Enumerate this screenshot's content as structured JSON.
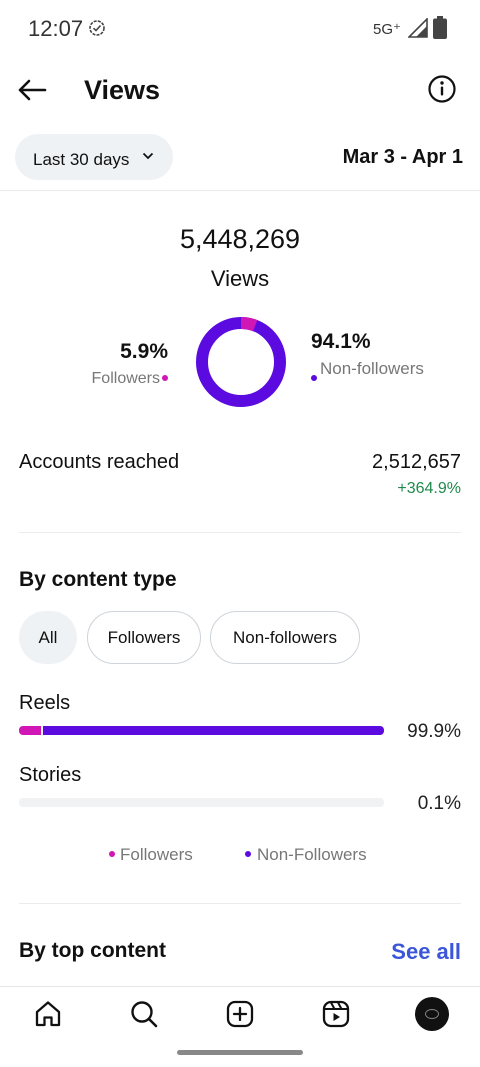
{
  "status_bar": {
    "time": "12:07",
    "network": "5G⁺",
    "icons": [
      "vpn-check-icon",
      "signal-icon",
      "battery-icon"
    ]
  },
  "header": {
    "title": "Views",
    "back_icon": "back-arrow-icon",
    "info_icon": "info-icon"
  },
  "filter": {
    "range_label": "Last 30 days",
    "date_range": "Mar 3 - Apr 1"
  },
  "summary": {
    "total_views": "5,448,269",
    "total_label": "Views",
    "followers_pct": "5.9%",
    "followers_label": "Followers",
    "non_followers_pct": "94.1%",
    "non_followers_label": "Non-followers",
    "followers_fraction": 0.059,
    "non_followers_fraction": 0.941
  },
  "accounts": {
    "label": "Accounts reached",
    "value": "2,512,657",
    "change": "+364.9%"
  },
  "by_content_type": {
    "title": "By content type",
    "chips": [
      {
        "label": "All",
        "selected": true
      },
      {
        "label": "Followers",
        "selected": false
      },
      {
        "label": "Non-followers",
        "selected": false
      }
    ],
    "rows": [
      {
        "label": "Reels",
        "percent": "99.9%",
        "followers_share": 0.059,
        "non_followers_share": 0.94
      },
      {
        "label": "Stories",
        "percent": "0.1%",
        "followers_share": 0.0,
        "non_followers_share": 0.0
      }
    ],
    "legend": {
      "followers": "Followers",
      "non_followers": "Non-Followers"
    }
  },
  "by_top_content": {
    "title": "By top content",
    "see_all": "See all"
  },
  "nav": {
    "items": [
      "home-icon",
      "search-icon",
      "create-icon",
      "reels-icon",
      "profile-avatar"
    ]
  },
  "colors": {
    "followers": "#d016b5",
    "non_followers": "#5b0be0",
    "positive": "#1f8a4c",
    "link": "#3b56d9"
  }
}
